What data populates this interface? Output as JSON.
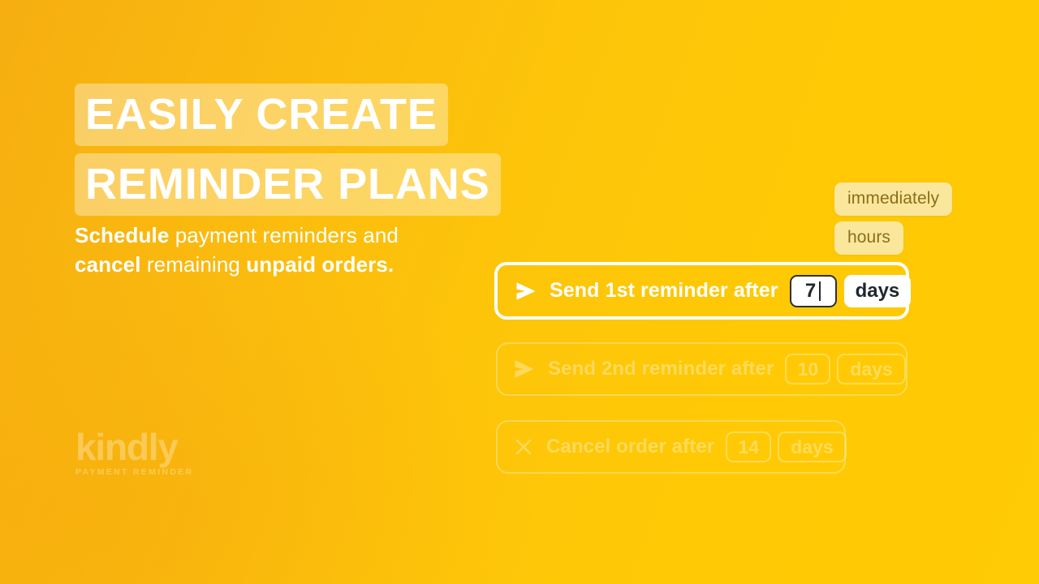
{
  "brand": {
    "logo_word": "kindly",
    "logo_tagline": "PAYMENT REMINDER"
  },
  "hero": {
    "headline_line1": "EASILY CREATE",
    "headline_line2": "REMINDER PLANS",
    "subtitle_part1": "Schedule",
    "subtitle_part2": " payment reminders and ",
    "subtitle_part3": "cancel",
    "subtitle_part4": " remaining ",
    "subtitle_part5": "unpaid orders."
  },
  "unit_options": [
    {
      "label": "immediately"
    },
    {
      "label": "hours"
    }
  ],
  "plan_rows": [
    {
      "id": "first-reminder",
      "icon": "send-icon",
      "label": "Send 1st reminder after",
      "value": "7",
      "unit": "days",
      "state": "active"
    },
    {
      "id": "second-reminder",
      "icon": "send-icon",
      "label": "Send 2nd reminder after",
      "value": "10",
      "unit": "days",
      "state": "ghost"
    },
    {
      "id": "cancel-order",
      "icon": "close-icon",
      "label": "Cancel order after",
      "value": "14",
      "unit": "days",
      "state": "ghost"
    }
  ],
  "colors": {
    "bg_start": "#F6AE10",
    "bg_end": "#FFCB04",
    "pill_bg": "#FBE79B",
    "pill_text": "#8A6E1B",
    "field_text": "#1F2630",
    "white": "#FFFFFF"
  }
}
